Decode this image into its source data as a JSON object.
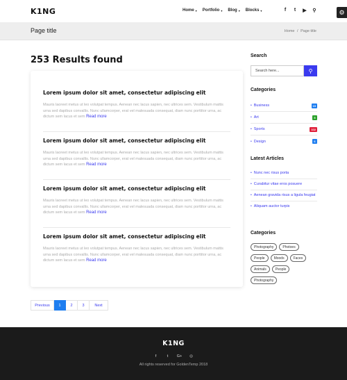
{
  "header": {
    "logo": "K1NG",
    "nav": [
      {
        "label": "Home",
        "caret": "▾"
      },
      {
        "label": "Portfolio",
        "caret": "▾"
      },
      {
        "label": "Blog",
        "caret": "▾"
      },
      {
        "label": "Blocks",
        "caret": "▾"
      }
    ],
    "social": [
      {
        "icon": "facebook-icon",
        "glyph": "f"
      },
      {
        "icon": "twitter-icon",
        "glyph": "t"
      },
      {
        "icon": "youtube-icon",
        "glyph": "▶"
      },
      {
        "icon": "search-icon",
        "glyph": "⚲"
      }
    ],
    "settings_glyph": "⚙"
  },
  "titlebar": {
    "title": "Page title",
    "breadcrumb_home": "Home",
    "breadcrumb_sep": "/",
    "breadcrumb_current": "Page title"
  },
  "main": {
    "results_title": "253 Results found",
    "articles": [
      {
        "title": "Lorem ipsum dolor sit amet, consectetur adipiscing elit",
        "text": "Mauris laoreet metus ut leo volutpat tempus. Aenean nec lacus sapien, nec ultrices sem. Vestibulum mattis urna sed dapibus convallis. Nunc ullamcorper, erat vel malesuada consequat, diam nunc porttitor urna, ac dictum sem lacus et sem",
        "read_more": "Read more"
      },
      {
        "title": "Lorem ipsum dolor sit amet, consectetur adipiscing elit",
        "text": "Mauris laoreet metus ut leo volutpat tempus. Aenean nec lacus sapien, nec ultrices sem. Vestibulum mattis urna sed dapibus convallis. Nunc ullamcorper, erat vel malesuada consequat, diam nunc porttitor urna, ac dictum sem lacus et sem",
        "read_more": "Read more"
      },
      {
        "title": "Lorem ipsum dolor sit amet, consectetur adipiscing elit",
        "text": "Mauris laoreet metus ut leo volutpat tempus. Aenean nec lacus sapien, nec ultrices sem. Vestibulum mattis urna sed dapibus convallis. Nunc ullamcorper, erat vel malesuada consequat, diam nunc porttitor urna, ac dictum sem lacus et sem",
        "read_more": "Read more"
      },
      {
        "title": "Lorem ipsum dolor sit amet, consectetur adipiscing elit",
        "text": "Mauris laoreet metus ut leo volutpat tempus. Aenean nec lacus sapien, nec ultrices sem. Vestibulum mattis urna sed dapibus convallis. Nunc ullamcorper, erat vel malesuada consequat, diam nunc porttitor urna, ac dictum sem lacus et sem",
        "read_more": "Read more"
      }
    ],
    "pagination": {
      "previous": "Previous",
      "pages": [
        "1",
        "2",
        "3"
      ],
      "current": "1",
      "next": "Next"
    }
  },
  "sidebar": {
    "search": {
      "heading": "Search",
      "placeholder": "Search here...",
      "button_glyph": "⚲"
    },
    "categories": {
      "heading": "Categories",
      "items": [
        {
          "label": "Business",
          "count": "15",
          "color": "#1e7ef0"
        },
        {
          "label": "Art",
          "count": "5",
          "color": "#2aa12a"
        },
        {
          "label": "Sports",
          "count": "102",
          "color": "#e0203a"
        },
        {
          "label": "Design",
          "count": "6",
          "color": "#1e7ef0"
        }
      ]
    },
    "latest_articles": {
      "heading": "Latest Articles",
      "items": [
        "Nunc nec risus porta",
        "Curabitur vitae eros posuere",
        "Aenean gravida risus a ligula feugiat",
        "Aliquam auctor turpis"
      ]
    },
    "tags": {
      "heading": "Categories",
      "items": [
        "Photography",
        "Photoes",
        "People",
        "Moods",
        "Faces",
        "Animals",
        "People",
        "Photography"
      ]
    }
  },
  "footer": {
    "logo": "K1NG",
    "social": [
      {
        "icon": "facebook-icon",
        "glyph": "f"
      },
      {
        "icon": "twitter-icon",
        "glyph": "t"
      },
      {
        "icon": "google-plus-icon",
        "glyph": "G+"
      },
      {
        "icon": "instagram-icon",
        "glyph": "◎"
      }
    ],
    "copyright": "All rights reserved for GoldenTemp 2018"
  },
  "colors": {
    "accent": "#3a3aef",
    "pagination_active": "#1e7ef0",
    "footer_bg": "#1b1b1b",
    "titlebar_bg": "#eeeeee"
  }
}
